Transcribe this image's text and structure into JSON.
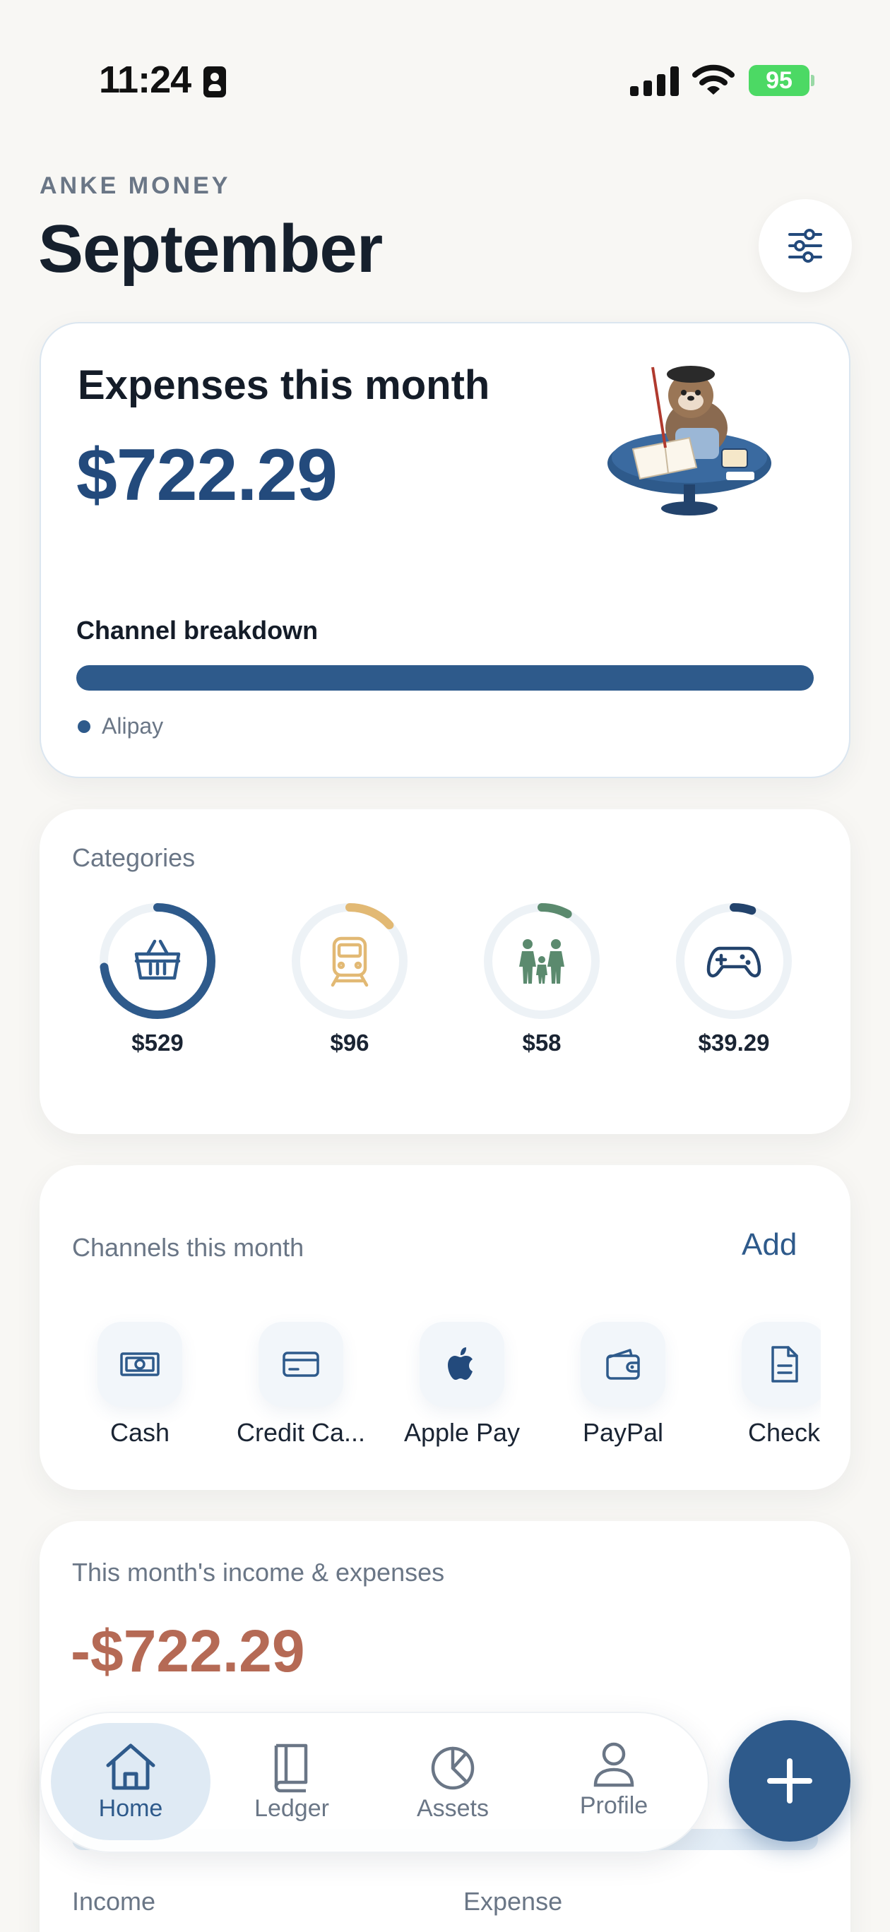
{
  "status_bar": {
    "time": "11:24",
    "battery": "95",
    "battery_charging": true
  },
  "header": {
    "brand": "ANKE MONEY",
    "month": "September",
    "filter_icon": "sliders-icon"
  },
  "expenses_card": {
    "title": "Expenses this month",
    "amount": "$722.29",
    "illustration": "otter-writing-ledger-illustration",
    "breakdown_title": "Channel breakdown",
    "channels": [
      {
        "name": "Alipay",
        "share": 1.0,
        "color": "#2e5a8b"
      }
    ]
  },
  "categories": {
    "title": "Categories",
    "items": [
      {
        "icon": "basket-icon",
        "amount": "$529",
        "share": 0.732,
        "color": "#2e5a8b"
      },
      {
        "icon": "train-icon",
        "amount": "$96",
        "share": 0.133,
        "color": "#e2b974"
      },
      {
        "icon": "family-icon",
        "amount": "$58",
        "share": 0.08,
        "color": "#5b8a6e"
      },
      {
        "icon": "gamepad-icon",
        "amount": "$39.29",
        "share": 0.054,
        "color": "#23436c"
      }
    ]
  },
  "channels_card": {
    "title": "Channels this month",
    "add_label": "Add",
    "items": [
      {
        "icon": "cash-icon",
        "label": "Cash"
      },
      {
        "icon": "credit-card-icon",
        "label": "Credit Ca..."
      },
      {
        "icon": "apple-icon",
        "label": "Apple Pay"
      },
      {
        "icon": "wallet-icon",
        "label": "PayPal"
      },
      {
        "icon": "document-icon",
        "label": "Check"
      }
    ]
  },
  "income_card": {
    "title": "This month's income & expenses",
    "net": "-$722.29",
    "income_label": "Income",
    "expense_label": "Expense"
  },
  "tab_bar": {
    "tabs": [
      {
        "icon": "home-icon",
        "label": "Home",
        "active": true
      },
      {
        "icon": "book-icon",
        "label": "Ledger",
        "active": false
      },
      {
        "icon": "pie-chart-icon",
        "label": "Assets",
        "active": false
      },
      {
        "icon": "person-icon",
        "label": "Profile",
        "active": false
      }
    ],
    "fab_icon": "plus-icon"
  },
  "colors": {
    "accent": "#2e5a8b",
    "negative": "#b56a55",
    "background": "#f8f7f4"
  }
}
